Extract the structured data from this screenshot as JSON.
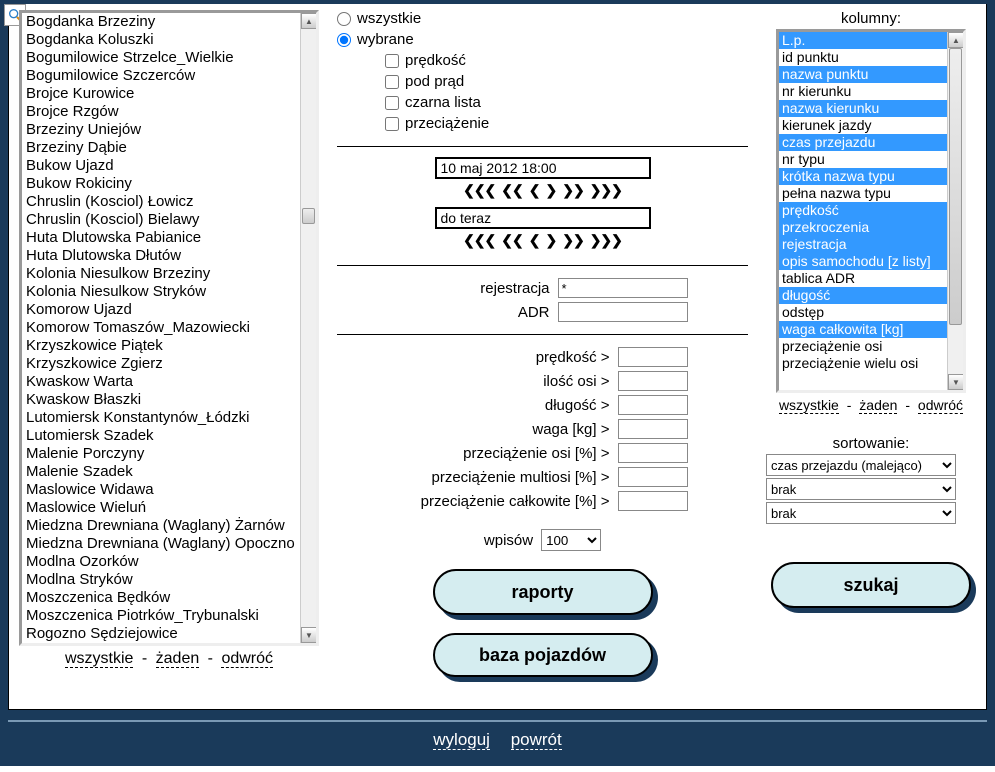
{
  "left": {
    "items": [
      "Bogdanka Brzeziny",
      "Bogdanka Koluszki",
      "Bogumilowice Strzelce_Wielkie",
      "Bogumilowice Szczerców",
      "Brojce Kurowice",
      "Brojce Rzgów",
      "Brzeziny Uniejów",
      "Brzeziny Dąbie",
      "Bukow Ujazd",
      "Bukow Rokiciny",
      "Chruslin (Kosciol) Łowicz",
      "Chruslin (Kosciol) Bielawy",
      "Huta Dlutowska Pabianice",
      "Huta Dlutowska Dłutów",
      "Kolonia Niesulkow Brzeziny",
      "Kolonia Niesulkow Stryków",
      "Komorow Ujazd",
      "Komorow Tomaszów_Mazowiecki",
      "Krzyszkowice Piątek",
      "Krzyszkowice Zgierz",
      "Kwaskow Warta",
      "Kwaskow Błaszki",
      "Lutomiersk Konstantynów_Łódzki",
      "Lutomiersk Szadek",
      "Malenie Porczyny",
      "Malenie Szadek",
      "Maslowice Widawa",
      "Maslowice Wieluń",
      "Miedzna Drewniana (Waglany) Żarnów",
      "Miedzna Drewniana (Waglany) Opoczno",
      "Modlna Ozorków",
      "Modlna Stryków",
      "Moszczenica Będków",
      "Moszczenica Piotrków_Trybunalski",
      "Rogozno Sędziejowice"
    ],
    "link_all": "wszystkie",
    "link_none": "żaden",
    "link_invert": "odwróć"
  },
  "mid": {
    "radio_all": "wszystkie",
    "radio_selected": "wybrane",
    "chk_speed": "prędkość",
    "chk_upstream": "pod prąd",
    "chk_blacklist": "czarna lista",
    "chk_overload": "przeciążenie",
    "time_from": "10 maj 2012 18:00",
    "time_to": "do teraz",
    "reg_label": "rejestracja",
    "reg_value": "*",
    "adr_label": "ADR",
    "adr_value": "",
    "f_speed": "prędkość >",
    "f_axles": "ilość osi >",
    "f_length": "długość >",
    "f_weight": "waga [kg] >",
    "f_ov_axle": "przeciążenie osi [%] >",
    "f_ov_multi": "przeciążenie multiosi [%] >",
    "f_ov_total": "przeciążenie całkowite [%] >",
    "wpisow_label": "wpisów",
    "wpisow_value": "100",
    "btn_raporty": "raporty",
    "btn_baza": "baza pojazdów"
  },
  "right": {
    "kolumny_header": "kolumny:",
    "kolumny": [
      {
        "label": "L.p.",
        "sel": true
      },
      {
        "label": "id punktu",
        "sel": false
      },
      {
        "label": "nazwa punktu",
        "sel": true
      },
      {
        "label": "nr kierunku",
        "sel": false
      },
      {
        "label": "nazwa kierunku",
        "sel": true
      },
      {
        "label": "kierunek jazdy",
        "sel": false
      },
      {
        "label": "czas przejazdu",
        "sel": true
      },
      {
        "label": "nr typu",
        "sel": false
      },
      {
        "label": "krótka nazwa typu",
        "sel": true
      },
      {
        "label": "pełna nazwa typu",
        "sel": false
      },
      {
        "label": "prędkość",
        "sel": true
      },
      {
        "label": "przekroczenia",
        "sel": true
      },
      {
        "label": "rejestracja",
        "sel": true
      },
      {
        "label": "opis samochodu [z listy]",
        "sel": true
      },
      {
        "label": "tablica ADR",
        "sel": false
      },
      {
        "label": "długość",
        "sel": true
      },
      {
        "label": "odstęp",
        "sel": false
      },
      {
        "label": "waga całkowita [kg]",
        "sel": true
      },
      {
        "label": "przeciążenie osi",
        "sel": false
      },
      {
        "label": "przeciążenie wielu osi",
        "sel": false
      }
    ],
    "link_all": "wszystkie",
    "link_none": "żaden",
    "link_invert": "odwróć",
    "sort_header": "sortowanie:",
    "sort1": "czas przejazdu (malejąco)",
    "sort2": "brak",
    "sort3": "brak",
    "btn_search": "szukaj"
  },
  "footer": {
    "logout": "wyloguj",
    "back": "powrót"
  }
}
